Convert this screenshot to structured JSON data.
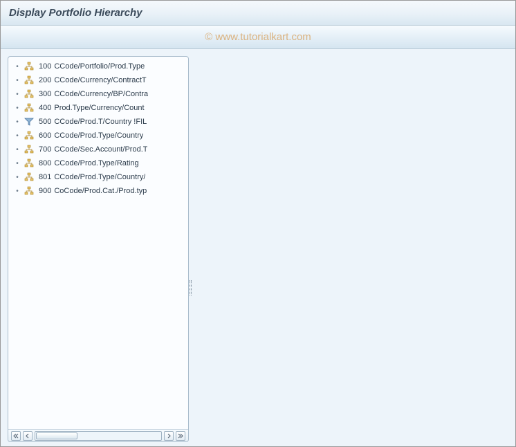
{
  "header": {
    "title": "Display Portfolio Hierarchy"
  },
  "watermark": "© www.tutorialkart.com",
  "tree": {
    "items": [
      {
        "code": "100",
        "label": "CCode/Portfolio/Prod.Type",
        "icon": "hierarchy"
      },
      {
        "code": "200",
        "label": "CCode/Currency/ContractT",
        "icon": "hierarchy"
      },
      {
        "code": "300",
        "label": "CCode/Currency/BP/Contra",
        "icon": "hierarchy"
      },
      {
        "code": "400",
        "label": "Prod.Type/Currency/Count",
        "icon": "hierarchy"
      },
      {
        "code": "500",
        "label": "CCode/Prod.T/Country !FIL",
        "icon": "filter"
      },
      {
        "code": "600",
        "label": "CCode/Prod.Type/Country",
        "icon": "hierarchy"
      },
      {
        "code": "700",
        "label": "CCode/Sec.Account/Prod.T",
        "icon": "hierarchy"
      },
      {
        "code": "800",
        "label": "CCode/Prod.Type/Rating",
        "icon": "hierarchy"
      },
      {
        "code": "801",
        "label": "CCode/Prod.Type/Country/",
        "icon": "hierarchy"
      },
      {
        "code": "900",
        "label": "CoCode/Prod.Cat./Prod.typ",
        "icon": "hierarchy"
      }
    ]
  },
  "icons": {
    "hierarchy": "hierarchy-icon",
    "filter": "filter-icon"
  }
}
